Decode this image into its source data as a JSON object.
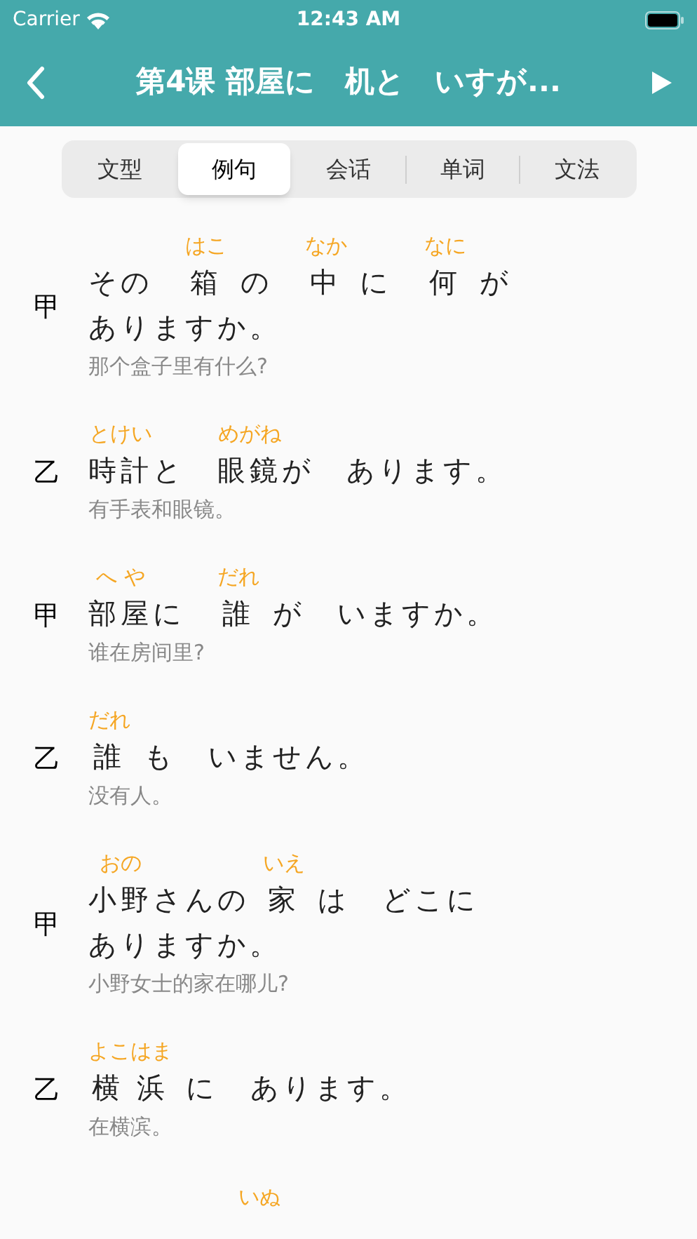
{
  "status_bar": {
    "carrier": "Carrier",
    "time": "12:43 AM"
  },
  "nav": {
    "title": "第4课 部屋に　机と　いすが..."
  },
  "tabs": [
    {
      "label": "文型",
      "selected": false
    },
    {
      "label": "例句",
      "selected": true
    },
    {
      "label": "会话",
      "selected": false
    },
    {
      "label": "单词",
      "selected": false
    },
    {
      "label": "文法",
      "selected": false
    }
  ],
  "sentences": [
    {
      "speaker": "甲",
      "segments": [
        {
          "text": "その　"
        },
        {
          "ruby": "はこ",
          "text": "箱"
        },
        {
          "text": " の　"
        },
        {
          "ruby": "なか",
          "text": "中"
        },
        {
          "text": " に　"
        },
        {
          "ruby": "なに",
          "text": "何"
        },
        {
          "text": " が　"
        },
        {
          "text": "あり"
        },
        {
          "text": "ますか。"
        }
      ],
      "translation": "那个盒子里有什么?"
    },
    {
      "speaker": "乙",
      "segments": [
        {
          "ruby": "とけい",
          "text": "時計"
        },
        {
          "text": "と　"
        },
        {
          "ruby": "めがね",
          "text": "眼鏡"
        },
        {
          "text": "が　"
        },
        {
          "text": "あります。"
        }
      ],
      "translation": "有手表和眼镜。"
    },
    {
      "speaker": "甲",
      "segments": [
        {
          "ruby": "へ や",
          "text": "部屋"
        },
        {
          "text": "に　"
        },
        {
          "ruby": "だれ",
          "text": "誰"
        },
        {
          "text": " が　"
        },
        {
          "text": "いますか。"
        }
      ],
      "translation": "谁在房间里?"
    },
    {
      "speaker": "乙",
      "segments": [
        {
          "ruby": "だれ",
          "text": "誰"
        },
        {
          "text": " も　"
        },
        {
          "text": "いません。"
        }
      ],
      "translation": "没有人。"
    },
    {
      "speaker": "甲",
      "segments": [
        {
          "ruby": "おの",
          "text": "小野"
        },
        {
          "text": "さんの "
        },
        {
          "ruby": "いえ",
          "text": "家"
        },
        {
          "text": " は　"
        },
        {
          "text": "どこに　"
        },
        {
          "text": "あります"
        },
        {
          "text": "か。"
        }
      ],
      "translation": "小野女士的家在哪儿?"
    },
    {
      "speaker": "乙",
      "segments": [
        {
          "ruby": "よこはま",
          "text": "横 浜"
        },
        {
          "text": " に　"
        },
        {
          "text": "あります。"
        }
      ],
      "translation": "在横滨。"
    }
  ],
  "next_ruby": "いぬ"
}
